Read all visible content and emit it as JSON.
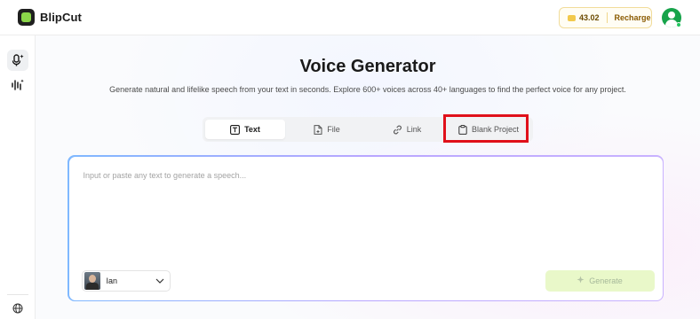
{
  "header": {
    "brand_name": "BlipCut",
    "credits_value": "43.02",
    "recharge_label": "Recharge"
  },
  "sidebar": {
    "items": [
      {
        "icon": "voice-sparkle-icon",
        "active": true
      },
      {
        "icon": "waveform-sparkle-icon",
        "active": false
      }
    ],
    "footer_icon": "globe-icon"
  },
  "main": {
    "title": "Voice Generator",
    "subtitle": "Generate natural and lifelike speech from your text in seconds. Explore 600+ voices across 40+ languages to find the perfect voice for any project.",
    "tabs": [
      {
        "label": "Text",
        "icon": "text-icon",
        "active": true
      },
      {
        "label": "File",
        "icon": "file-icon",
        "active": false
      },
      {
        "label": "Link",
        "icon": "link-icon",
        "active": false
      },
      {
        "label": "Blank Project",
        "icon": "clipboard-icon",
        "active": false
      }
    ],
    "editor": {
      "placeholder": "Input or paste any text to generate a speech...",
      "value": ""
    },
    "voice": {
      "name": "Ian"
    },
    "generate_label": "Generate"
  },
  "colors": {
    "brand_green": "#8bd64a",
    "highlight_red": "#e0101a",
    "generate_bg": "#e9f8c9",
    "avatar_green": "#16a34a"
  }
}
